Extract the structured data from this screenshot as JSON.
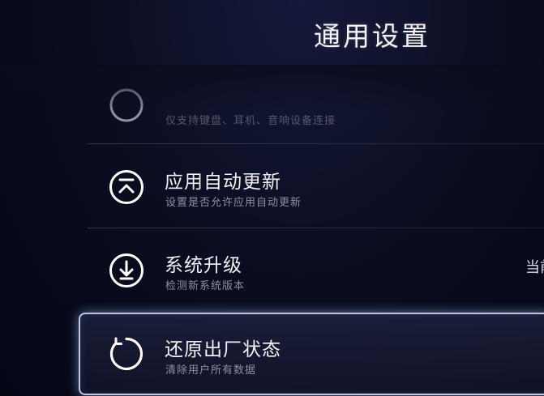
{
  "header": {
    "title": "通用设置"
  },
  "settings": {
    "peripheral": {
      "subtitle": "仅支持键盘、耳机、音响设备连接",
      "icon": "connection-icon"
    },
    "auto_update": {
      "title": "应用自动更新",
      "subtitle": "设置是否允许应用自动更新",
      "icon": "chevron-up-circle-icon"
    },
    "system_upgrade": {
      "title": "系统升级",
      "subtitle": "检测新系统版本",
      "value": "当前",
      "icon": "download-circle-icon"
    },
    "factory_reset": {
      "title": "还原出厂状态",
      "subtitle": "清除用户所有数据",
      "icon": "restore-icon",
      "focused": true
    }
  },
  "colors": {
    "background": "#0b0e22",
    "text_primary": "#f2f3f8",
    "text_secondary": "#8c90a3",
    "focus_border": "#dce8ff"
  }
}
